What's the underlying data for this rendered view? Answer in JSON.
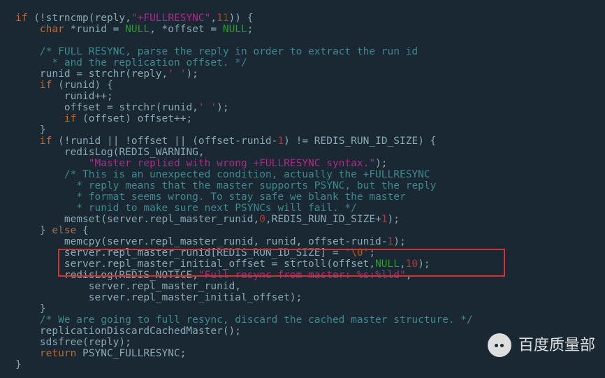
{
  "code": {
    "l1a": "if",
    "l1b": " (!strncmp(reply,",
    "l1c": "\"+FULLRESYNC\"",
    "l1d": ",",
    "l1e": "11",
    "l1f": ")) {",
    "l2a": "char",
    "l2b": " *runid = ",
    "l2c": "NULL",
    "l2d": ", *offset = ",
    "l2e": "NULL",
    "l2f": ";",
    "l3": "/* FULL RESYNC, parse the reply in order to extract the run id",
    "l4": " * and the replication offset. */",
    "l5a": "runid = strchr(reply,",
    "l5b": "' '",
    "l5c": ");",
    "l6a": "if",
    "l6b": " (runid) {",
    "l7": "runid++;",
    "l8a": "offset = strchr(runid,",
    "l8b": "' '",
    "l8c": ");",
    "l9a": "if",
    "l9b": " (offset) offset++;",
    "l10": "}",
    "l11a": "if",
    "l11b": " (!runid || !offset || (offset-runid-",
    "l11c": "1",
    "l11d": ") != REDIS_RUN_ID_SIZE) {",
    "l12": "redisLog(REDIS_WARNING,",
    "l13": "\"Master replied with wrong +FULLRESYNC syntax.\"",
    "l13b": ");",
    "l14": "/* This is an unexpected condition, actually the +FULLRESYNC",
    "l15": " * reply means that the master supports PSYNC, but the reply",
    "l16": " * format seems wrong. To stay safe we blank the master",
    "l17": " * runid to make sure next PSYNCs will fail. */",
    "l18a": "memset(server.repl_master_runid,",
    "l18b": "0",
    "l18c": ",REDIS_RUN_ID_SIZE+",
    "l18d": "1",
    "l18e": ");",
    "l19a": "} ",
    "l19b": "else",
    "l19c": " {",
    "l20a": "memcpy(server.repl_master_runid, runid, offset-runid-",
    "l20b": "1",
    "l20c": ");",
    "l21a": "server.repl_master_runid[REDIS_RUN_ID_SIZE] = ",
    "l21b": "'\\0'",
    "l21c": ";",
    "l22a": "server.repl_master_initial_offset = strtoll(offset,",
    "l22b": "NULL",
    "l22c": ",",
    "l22d": "10",
    "l22e": ");",
    "l23a": "redisLog(REDIS_NOTICE,",
    "l23b": "\"Full resync from master: %s:%lld\"",
    "l23c": ",",
    "l24": "server.repl_master_runid,",
    "l25": "server.repl_master_initial_offset);",
    "l26": "}",
    "l27": "/* We are going to full resync, discard the cached master structure. */",
    "l28": "replicationDiscardCachedMaster();",
    "l29": "sdsfree(reply);",
    "l30a": "return",
    "l30b": " PSYNC_FULLRESYNC;",
    "l31": "}"
  },
  "watermark": {
    "text": "百度质量部"
  }
}
